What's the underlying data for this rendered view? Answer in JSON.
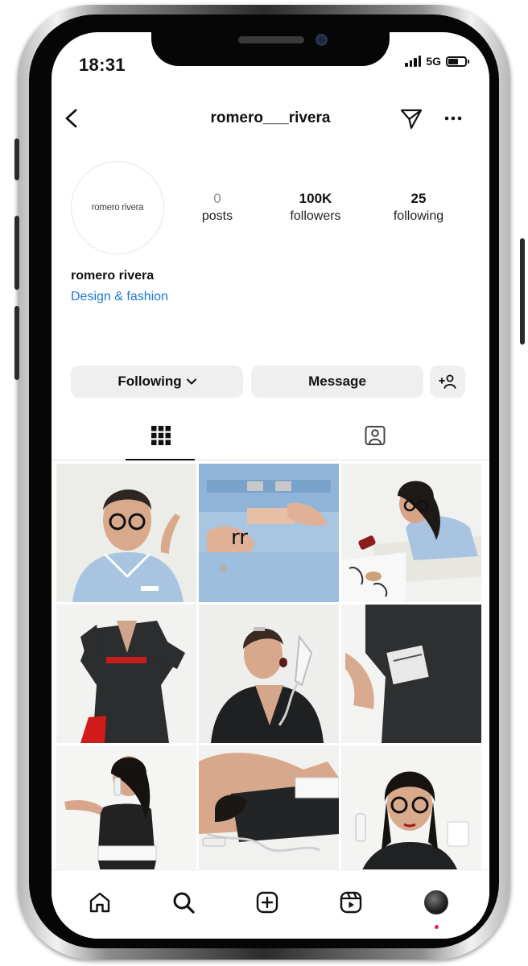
{
  "status_bar": {
    "time": "18:31",
    "network": "5G",
    "signal_icon": "signal-bars-icon",
    "battery_icon": "battery-icon"
  },
  "header": {
    "username": "romero___rivera",
    "back_icon": "chevron-left-icon",
    "send_icon": "paper-plane-icon",
    "more_icon": "ellipsis-icon"
  },
  "profile": {
    "avatar_text": "romero rivera",
    "stats": [
      {
        "value": "0",
        "label": "posts"
      },
      {
        "value": "100K",
        "label": "followers"
      },
      {
        "value": "25",
        "label": "following"
      }
    ],
    "display_name": "romero rivera",
    "bio": "Design & fashion"
  },
  "actions": {
    "following_label": "Following",
    "message_label": "Message",
    "add_person_icon": "add-person-icon"
  },
  "tabs": [
    {
      "icon": "grid-icon",
      "active": true
    },
    {
      "icon": "tagged-person-icon",
      "active": false
    }
  ],
  "posts": [
    {
      "description": "woman holding glasses, light blue shirt"
    },
    {
      "description": "light blue belted denim close-up"
    },
    {
      "description": "woman with glasses reading magazine"
    },
    {
      "description": "black suit with red belt"
    },
    {
      "description": "woman shouting into phone receiver"
    },
    {
      "description": "black blazer sleeve with label"
    },
    {
      "description": "woman in black top with phone cord"
    },
    {
      "description": "woman lying with black skirt"
    },
    {
      "description": "woman with red glasses holding phone"
    }
  ],
  "bottom_nav": [
    {
      "icon": "home-icon"
    },
    {
      "icon": "search-icon"
    },
    {
      "icon": "create-post-icon"
    },
    {
      "icon": "reels-icon"
    },
    {
      "icon": "profile-avatar-icon"
    }
  ],
  "colors": {
    "accent_link": "#1a78d6",
    "button_bg": "#efefef",
    "text": "#111111"
  }
}
